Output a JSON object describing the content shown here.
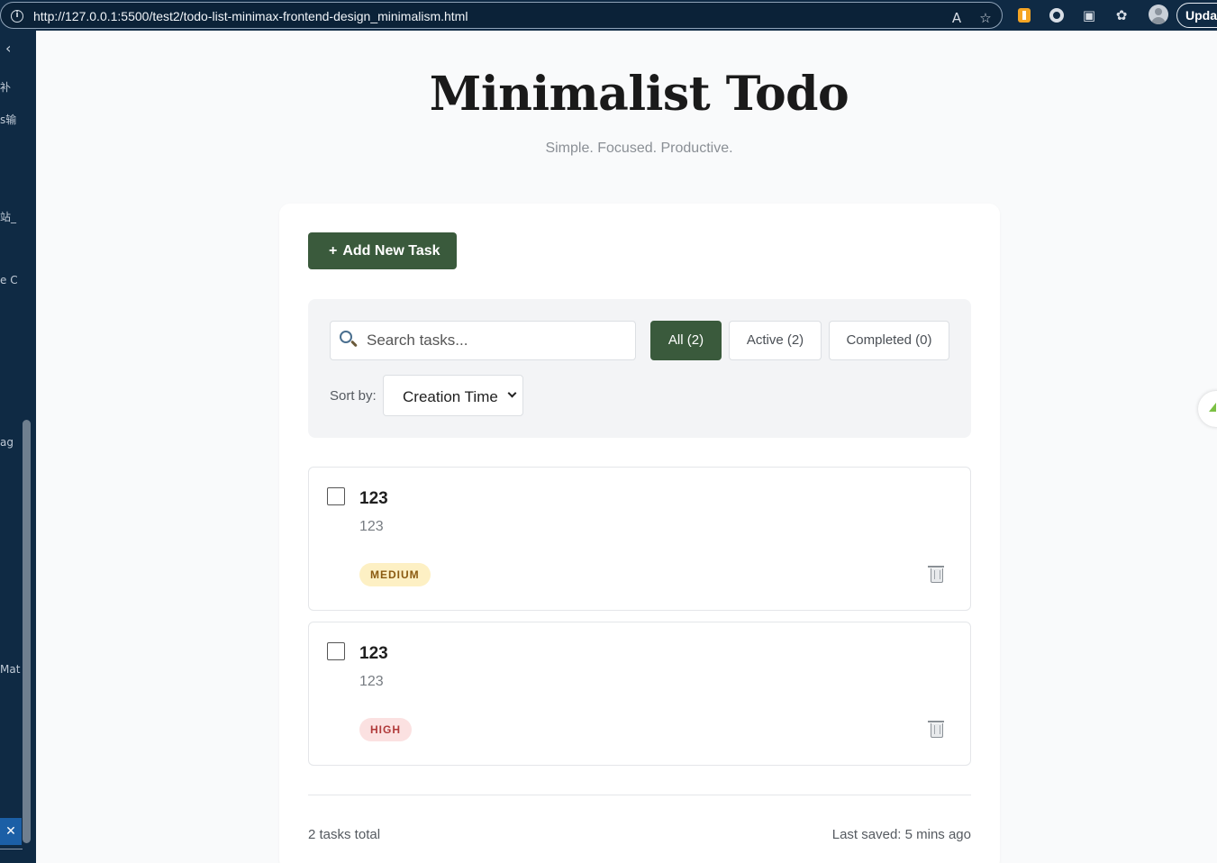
{
  "browser": {
    "url": "http://127.0.0.1:5500/test2/todo-list-minimax-frontend-design_minimalism.html",
    "update_label": "Update"
  },
  "side_panel": {
    "fragments": [
      "补",
      "s输",
      "站_",
      "e C",
      "ag",
      "Mat"
    ]
  },
  "header": {
    "title": "Minimalist Todo",
    "subtitle": "Simple. Focused. Productive."
  },
  "actions": {
    "add_label": "Add New Task",
    "add_icon": "+"
  },
  "search": {
    "placeholder": "Search tasks..."
  },
  "filters": [
    {
      "label": "All (2)",
      "active": true
    },
    {
      "label": "Active (2)",
      "active": false
    },
    {
      "label": "Completed (0)",
      "active": false
    }
  ],
  "sort": {
    "label": "Sort by:",
    "selected": "Creation Time"
  },
  "tasks": [
    {
      "title": "123",
      "description": "123",
      "priority": "MEDIUM",
      "completed": false
    },
    {
      "title": "123",
      "description": "123",
      "priority": "HIGH",
      "completed": false
    }
  ],
  "footer": {
    "count": "2 tasks total",
    "saved": "Last saved: 5 mins ago"
  },
  "colors": {
    "accent": "#3a5a3c",
    "browser_chrome": "#0f2a44",
    "priority_medium_bg": "#fdf0c4",
    "priority_high_bg": "#fbe1e1"
  }
}
